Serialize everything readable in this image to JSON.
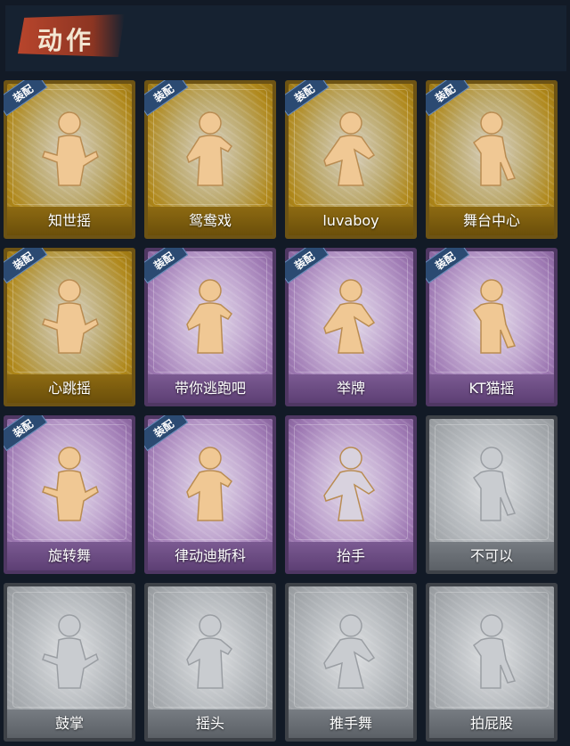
{
  "header": {
    "title": "动作"
  },
  "badge_text": "装配",
  "colors": {
    "gold": "#b0881a",
    "purple": "#9e79b3",
    "grey": "#8e9296",
    "badge": "#2b4a72",
    "title_banner": "#b8452c"
  },
  "actions": [
    {
      "label": "知世摇",
      "tier": "gold",
      "equipped": true,
      "icon": "dancer-arms-out-icon"
    },
    {
      "label": "鸳鸯戏",
      "tier": "gold",
      "equipped": true,
      "icon": "dancer-pose-icon"
    },
    {
      "label": "luvaboy",
      "tier": "gold",
      "equipped": true,
      "icon": "dancer-cross-arms-icon"
    },
    {
      "label": "舞台中心",
      "tier": "gold",
      "equipped": true,
      "icon": "dancer-sparkle-icon"
    },
    {
      "label": "心跳摇",
      "tier": "gold",
      "equipped": true,
      "icon": "dancer-wave-icon"
    },
    {
      "label": "带你逃跑吧",
      "tier": "purple",
      "equipped": true,
      "icon": "dancer-point-icon"
    },
    {
      "label": "举牌",
      "tier": "purple",
      "equipped": true,
      "icon": "hold-sign-icon"
    },
    {
      "label": "KT猫摇",
      "tier": "purple",
      "equipped": true,
      "icon": "dancer-mic-icon"
    },
    {
      "label": "旋转舞",
      "tier": "purple",
      "equipped": true,
      "icon": "dancer-spin-icon"
    },
    {
      "label": "律动迪斯科",
      "tier": "purple",
      "equipped": true,
      "icon": "dancer-disco-icon"
    },
    {
      "label": "抬手",
      "tier": "purple",
      "equipped": false,
      "icon": "raise-hand-icon"
    },
    {
      "label": "不可以",
      "tier": "grey",
      "equipped": false,
      "icon": "finger-wag-icon"
    },
    {
      "label": "鼓掌",
      "tier": "grey",
      "equipped": false,
      "icon": "clap-icon"
    },
    {
      "label": "摇头",
      "tier": "grey",
      "equipped": false,
      "icon": "shake-head-icon"
    },
    {
      "label": "推手舞",
      "tier": "grey",
      "equipped": false,
      "icon": "push-dance-icon"
    },
    {
      "label": "拍屁股",
      "tier": "grey",
      "equipped": false,
      "icon": "butt-slap-icon"
    }
  ]
}
